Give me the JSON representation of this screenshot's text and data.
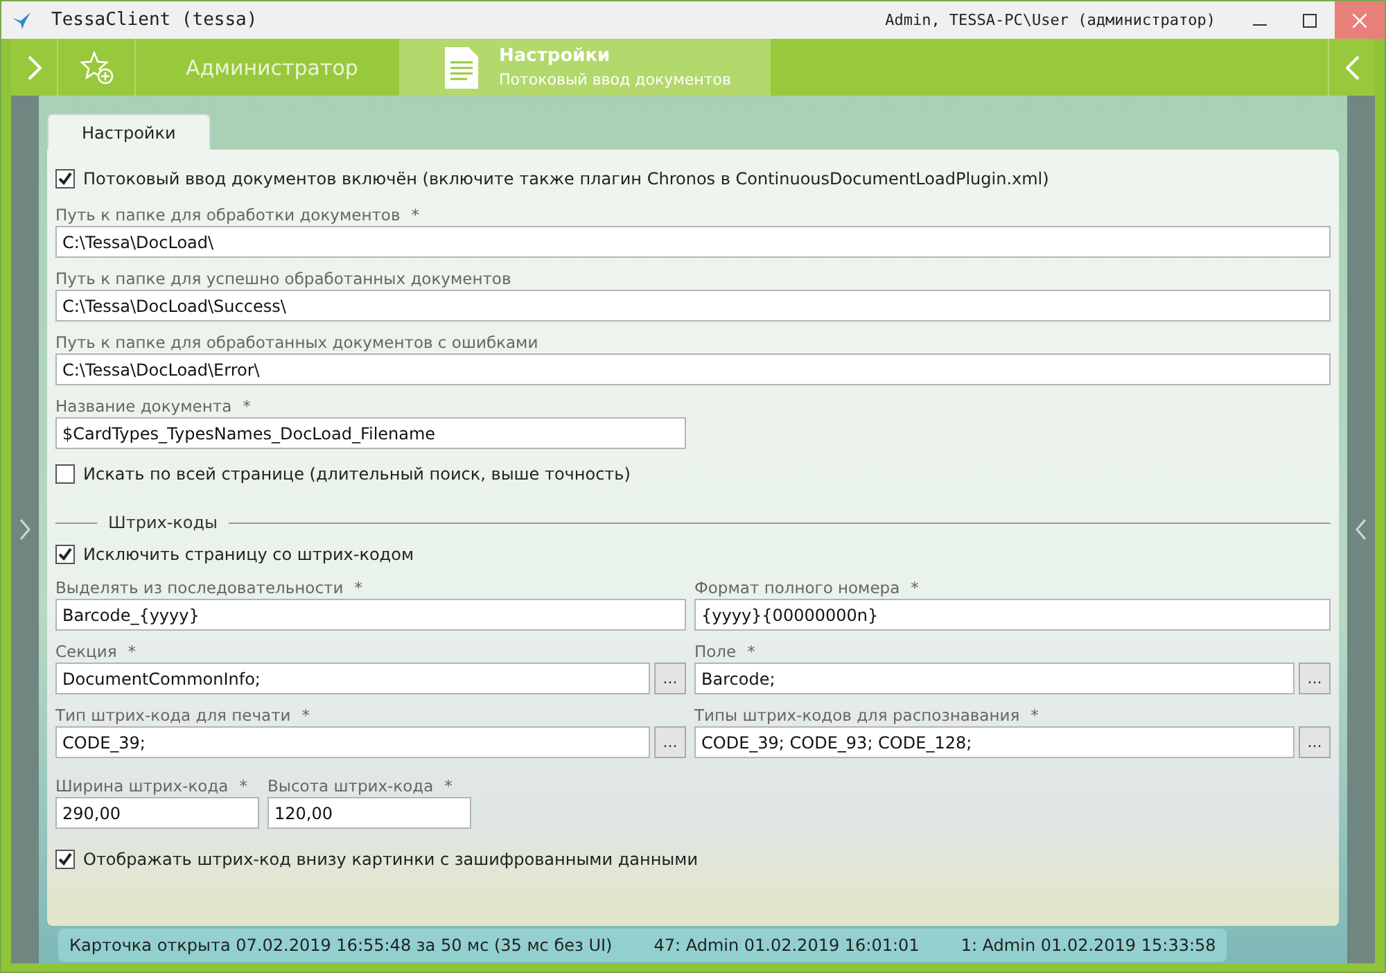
{
  "window": {
    "title": "TessaClient (tessa)",
    "user": "Admin, TESSA-PC\\User (администратор)"
  },
  "nav": {
    "home_label": "Администратор",
    "active_tab": {
      "title": "Настройки",
      "subtitle": "Потоковый ввод документов"
    }
  },
  "tabs": [
    {
      "label": "Настройки",
      "selected": true
    }
  ],
  "enabled_checkbox": {
    "label": "Потоковый ввод документов включён (включите также плагин Chronos в ContinuousDocumentLoadPlugin.xml)",
    "checked": true
  },
  "paths": [
    {
      "label": "Путь к папке для обработки документов",
      "required_mark": "*",
      "value": "C:\\Tessa\\DocLoad\\"
    },
    {
      "label": "Путь к папке для успешно обработанных документов",
      "value": "C:\\Tessa\\DocLoad\\Success\\"
    },
    {
      "label": "Путь к папке для обработанных документов с ошибками",
      "value": "C:\\Tessa\\DocLoad\\Error\\"
    }
  ],
  "document_name": {
    "label": "Название документа",
    "required_mark": "*",
    "value": "$CardTypes_TypesNames_DocLoad_Filename"
  },
  "search_all_checkbox": {
    "label": "Искать по всей странице (длительный поиск, выше точность)",
    "checked": false
  },
  "barcodes": {
    "title": "Штрих-коды",
    "exclude_checkbox": {
      "label": "Исключить страницу со штрих-кодом",
      "checked": true
    },
    "grid": [
      {
        "label": "Выделять из последовательности",
        "required_mark": "*",
        "value": "Barcode_{yyyy}"
      },
      {
        "label": "Формат полного номера",
        "required_mark": "*",
        "value": "{yyyy}{00000000n}"
      },
      {
        "label": "Секция",
        "required_mark": "*",
        "value": "DocumentCommonInfo;",
        "button": "..."
      },
      {
        "label": "Поле",
        "required_mark": "*",
        "value": "Barcode;",
        "button": "..."
      },
      {
        "label": "Тип штрих-кода для печати",
        "required_mark": "*",
        "value": "CODE_39;",
        "button": "..."
      },
      {
        "label": "Типы штрих-кодов для распознавания",
        "required_mark": "*",
        "value": "CODE_39; CODE_93; CODE_128;",
        "button": "..."
      }
    ],
    "size_fields": [
      {
        "label": "Ширина штрих-кода",
        "required_mark": "*",
        "value": "290,00"
      },
      {
        "label": "Высота штрих-кода",
        "required_mark": "*",
        "value": "120,00"
      }
    ],
    "show_checkbox": {
      "label": "Отображать штрих-код внизу картинки с зашифрованными данными",
      "checked": true
    }
  },
  "status_bar": [
    "Карточка открыта 07.02.2019 16:55:48 за 50 мс (35 мс без UI)",
    "47:  Admin  01.02.2019 16:01:01",
    "1:  Admin  01.02.2019 15:33:58"
  ]
}
